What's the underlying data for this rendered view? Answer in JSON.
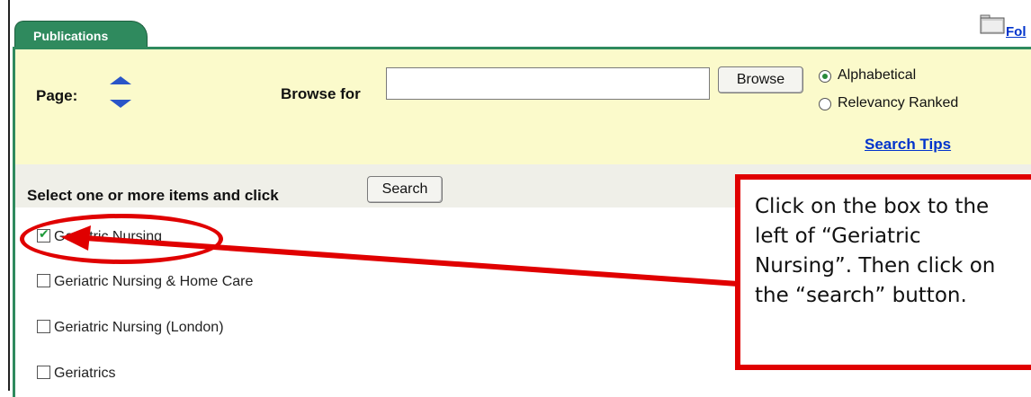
{
  "tab": {
    "label": "Publications"
  },
  "folder": {
    "link_text": "Fol"
  },
  "browse": {
    "page_label": "Page:",
    "browse_for_label": "Browse for",
    "input_value": "",
    "browse_button": "Browse",
    "sort_options": [
      {
        "label": "Alphabetical",
        "selected": true
      },
      {
        "label": "Relevancy Ranked",
        "selected": false
      }
    ],
    "search_tips": "Search Tips"
  },
  "select_bar": {
    "instruction": "Select one or more items and click",
    "search_button": "Search"
  },
  "results": [
    {
      "label": "Geriatric Nursing",
      "checked": true
    },
    {
      "label": "Geriatric Nursing & Home Care",
      "checked": false
    },
    {
      "label": "Geriatric Nursing (London)",
      "checked": false
    },
    {
      "label": "Geriatrics",
      "checked": false
    }
  ],
  "annotation": {
    "callout_text": "Click on the box to the left of “Geriatric Nursing”. Then click on the “search” button.",
    "color": "#e00000"
  },
  "colors": {
    "tab_green": "#2f8a5e",
    "panel_yellow": "#fbfacb",
    "link_blue": "#0033cc"
  }
}
